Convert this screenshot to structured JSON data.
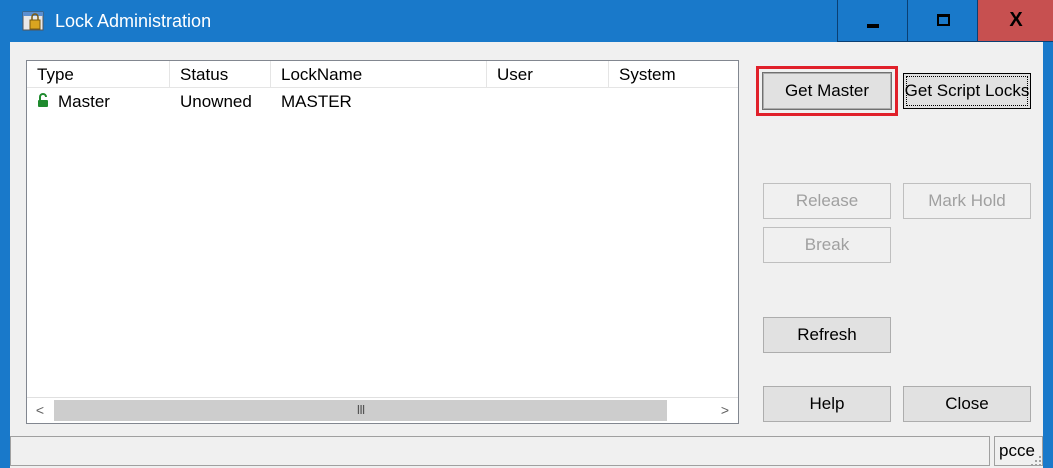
{
  "window": {
    "title": "Lock Administration",
    "icon": "lock-admin-app-icon",
    "controls": {
      "minimize": "minimize-icon",
      "maximize": "maximize-icon",
      "close_glyph": "X"
    }
  },
  "listview": {
    "columns": [
      "Type",
      "Status",
      "LockName",
      "User",
      "System"
    ],
    "rows": [
      {
        "icon": "unlocked-padlock-icon",
        "type": "Master",
        "status": "Unowned",
        "lockname": "MASTER",
        "user": "",
        "system": ""
      }
    ],
    "scrollbar": {
      "left_arrow": "<",
      "right_arrow": ">",
      "grip": "III"
    }
  },
  "buttons": {
    "get_master": {
      "label": "Get Master",
      "enabled": true
    },
    "get_script_locks": {
      "label": "Get Script Locks",
      "enabled": true
    },
    "release": {
      "label": "Release",
      "enabled": false
    },
    "mark_hold": {
      "label": "Mark Hold",
      "enabled": false
    },
    "break": {
      "label": "Break",
      "enabled": false
    },
    "refresh": {
      "label": "Refresh",
      "enabled": true
    },
    "help": {
      "label": "Help",
      "enabled": true
    },
    "close": {
      "label": "Close",
      "enabled": true
    }
  },
  "statusbar": {
    "main": "",
    "right": "pcce"
  },
  "colors": {
    "titlebar": "#1979ca",
    "close_button": "#c75050",
    "highlight": "#e0202a",
    "lock_icon": "#1f8a2e"
  }
}
